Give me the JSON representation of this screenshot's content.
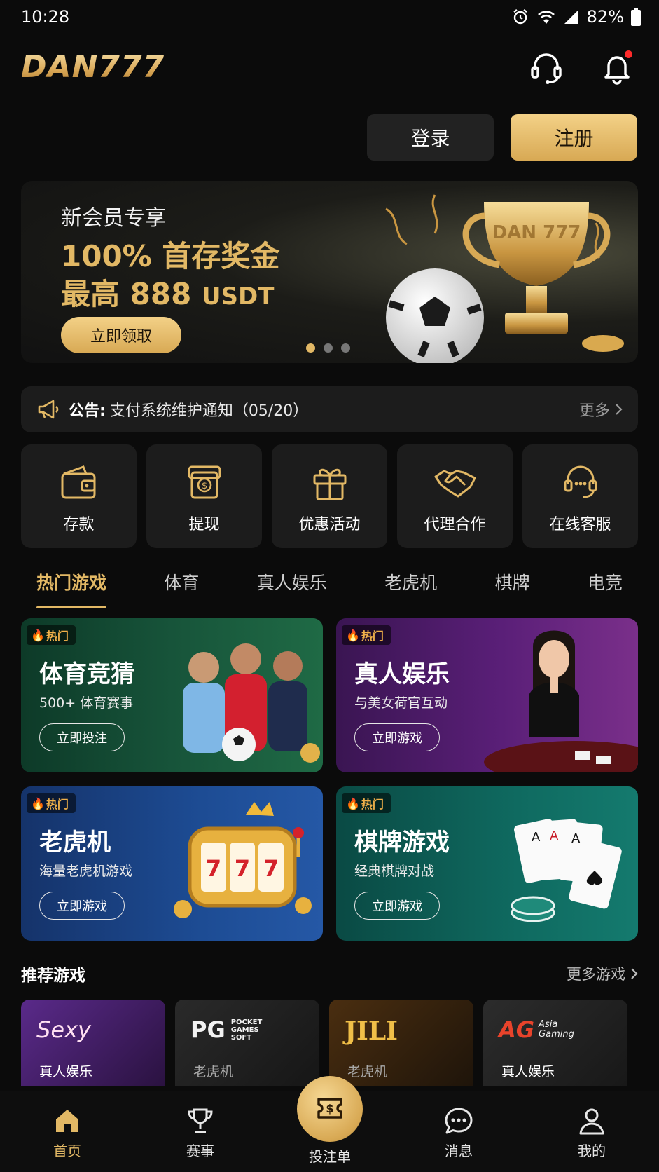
{
  "status_bar": {
    "time": "10:28",
    "battery": "82%"
  },
  "header": {
    "logo": "DAN777"
  },
  "auth": {
    "login": "登录",
    "register": "注册"
  },
  "banner": {
    "subtitle": "新会员专享",
    "line1": "100% 首存奖金",
    "line2_prefix": "最高 888",
    "line2_unit": "USDT",
    "cta": "立即领取",
    "trophy_text": "DAN 777",
    "slide_count": 3,
    "active_slide": 1
  },
  "notice": {
    "label": "公告:",
    "text": "支付系统维护通知（05/20）",
    "more": "更多"
  },
  "quick_actions": [
    {
      "label": "存款",
      "icon": "wallet-icon"
    },
    {
      "label": "提现",
      "icon": "withdraw-icon"
    },
    {
      "label": "优惠活动",
      "icon": "gift-icon"
    },
    {
      "label": "代理合作",
      "icon": "handshake-icon"
    },
    {
      "label": "在线客服",
      "icon": "support-icon"
    }
  ],
  "tabs": [
    "热门游戏",
    "体育",
    "真人娱乐",
    "老虎机",
    "棋牌",
    "电竞"
  ],
  "active_tab": 0,
  "game_cards": [
    {
      "badge": "热门",
      "title": "体育竞猜",
      "subtitle": "500+ 体育赛事",
      "button": "立即投注"
    },
    {
      "badge": "热门",
      "title": "真人娱乐",
      "subtitle": "与美女荷官互动",
      "button": "立即游戏"
    },
    {
      "badge": "热门",
      "title": "老虎机",
      "subtitle": "海量老虎机游戏",
      "button": "立即游戏"
    },
    {
      "badge": "热门",
      "title": "棋牌游戏",
      "subtitle": "经典棋牌对战",
      "button": "立即游戏"
    }
  ],
  "recommended": {
    "title": "推荐游戏",
    "more": "更多游戏",
    "items": [
      {
        "brand": "Sexy",
        "label": "真人娱乐"
      },
      {
        "brand": "PG",
        "brand_sub": "POCKET GAMES SOFT",
        "label": "老虎机"
      },
      {
        "brand": "JILI",
        "label": "老虎机"
      },
      {
        "brand": "AG",
        "brand_sub": "Asia Gaming",
        "label": "真人娱乐"
      }
    ]
  },
  "bottom_nav": [
    {
      "label": "首页",
      "icon": "home-icon",
      "active": true
    },
    {
      "label": "赛事",
      "icon": "trophy-icon",
      "active": false
    },
    {
      "label": "投注单",
      "icon": "bet-slip-icon",
      "active": false
    },
    {
      "label": "消息",
      "icon": "message-icon",
      "active": false
    },
    {
      "label": "我的",
      "icon": "profile-icon",
      "active": false
    }
  ],
  "colors": {
    "background": "#0b0b0b",
    "gold": "#e2b865",
    "card": "#1c1c1c",
    "notification": "#ff2a2a"
  }
}
